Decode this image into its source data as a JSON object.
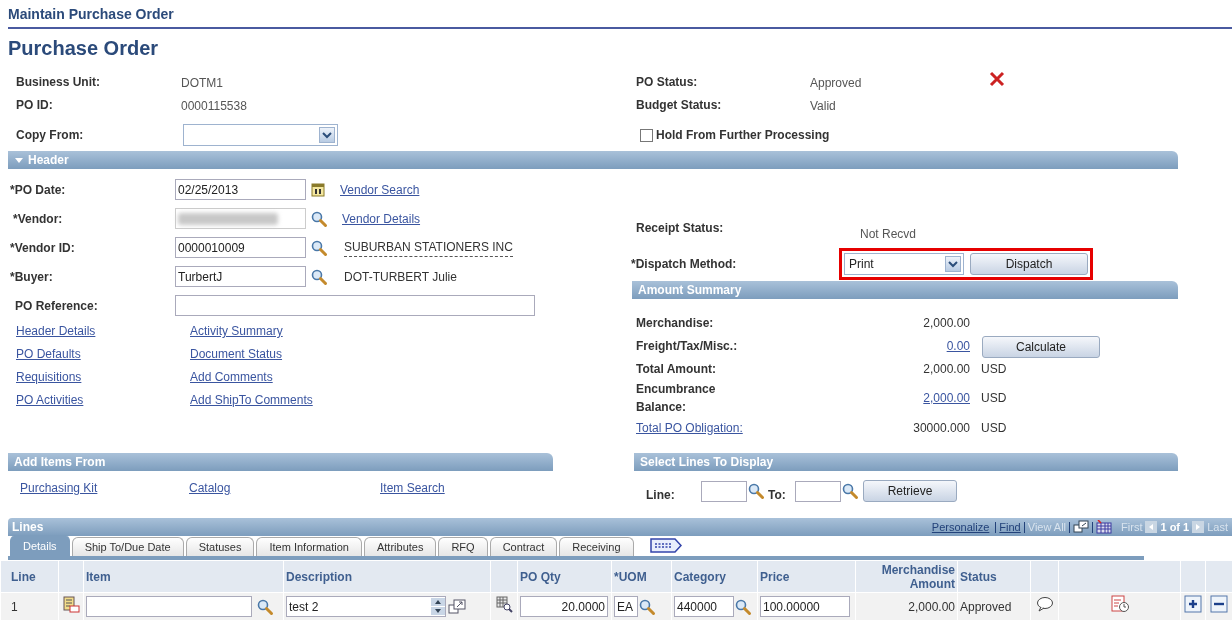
{
  "breadcrumb": "Maintain Purchase Order",
  "title": "Purchase Order",
  "summary_left": [
    {
      "label": "Business Unit:",
      "value": "DOTM1"
    },
    {
      "label": "PO ID:",
      "value": "0000115538"
    }
  ],
  "copy_from": {
    "label": "Copy From:"
  },
  "summary_right": [
    {
      "label": "PO Status:",
      "value": "Approved"
    },
    {
      "label": "Budget Status:",
      "value": "Valid"
    }
  ],
  "hold": {
    "label": "Hold From Further Processing",
    "checked": false
  },
  "header_section": {
    "title": "Header",
    "expanded": true
  },
  "header_fields": [
    {
      "kind": "date",
      "label": "*PO Date:",
      "value": "02/25/2013",
      "link": "Vendor Search"
    },
    {
      "kind": "redacted",
      "label": "*Vendor:",
      "link": "Vendor Details"
    },
    {
      "kind": "lookup",
      "label": "*Vendor ID:",
      "value": "0000010009",
      "description": "SUBURBAN STATIONERS INC",
      "underlined": true
    },
    {
      "kind": "lookup",
      "label": "*Buyer:",
      "value": "TurbertJ",
      "description": "DOT-TURBERT Julie",
      "underlined": false
    },
    {
      "kind": "wide",
      "label": "PO Reference:"
    }
  ],
  "header_links": [
    "Header Details",
    "Activity Summary",
    "PO Defaults",
    "Document Status",
    "Requisitions",
    "Add Comments",
    "PO Activities",
    "Add ShipTo Comments"
  ],
  "receipt_status": {
    "label": "Receipt Status:",
    "value": "Not Recvd"
  },
  "dispatch": {
    "label": "*Dispatch Method:",
    "value": "Print",
    "button": "Dispatch",
    "highlighted": true
  },
  "amount_summary": {
    "title": "Amount Summary",
    "button": "Calculate",
    "rows": [
      {
        "label": "Merchandise:",
        "label_link": false,
        "value": "2,000.00",
        "value_link": false
      },
      {
        "label": "Freight/Tax/Misc.:",
        "label_link": false,
        "value": "0.00",
        "value_link": true
      },
      {
        "label": "Total Amount:",
        "label_link": false,
        "value": "2,000.00",
        "value_link": false,
        "currency": "USD"
      },
      {
        "label": "Encumbrance Balance:",
        "label_link": false,
        "value": "2,000.00",
        "value_link": true,
        "currency": "USD"
      },
      {
        "label": "Total PO Obligation:",
        "label_link": true,
        "value": "30000.000",
        "value_link": false,
        "currency": "USD"
      }
    ]
  },
  "add_items": {
    "title": "Add Items From",
    "links": [
      "Purchasing Kit",
      "Catalog",
      "Item Search"
    ]
  },
  "select_lines": {
    "title": "Select Lines To Display",
    "line_label": "Line:",
    "to_label": "To:",
    "button": "Retrieve"
  },
  "lines": {
    "title": "Lines",
    "nav": {
      "personalize": "Personalize",
      "find": "Find",
      "view_all": "View All",
      "first": "First",
      "count": "1 of 1",
      "last": "Last"
    },
    "tabs": [
      {
        "label": "Details",
        "selected": true
      },
      {
        "label": "Ship To/Due Date",
        "selected": false
      },
      {
        "label": "Statuses",
        "selected": false
      },
      {
        "label": "Item Information",
        "selected": false
      },
      {
        "label": "Attributes",
        "selected": false
      },
      {
        "label": "RFQ",
        "selected": false
      },
      {
        "label": "Contract",
        "selected": false
      },
      {
        "label": "Receiving",
        "selected": false
      }
    ],
    "columns": [
      "Line",
      "Item",
      "Description",
      "PO Qty",
      "*UOM",
      "Category",
      "Price",
      "Merchandise Amount",
      "Status"
    ],
    "rows": [
      {
        "line": "1",
        "item": "",
        "description": "test 2",
        "po_qty": "20.0000",
        "uom": "EA",
        "category": "440000",
        "price": "100.00000",
        "merchandise_amount": "2,000.00",
        "status": "Approved"
      }
    ]
  }
}
